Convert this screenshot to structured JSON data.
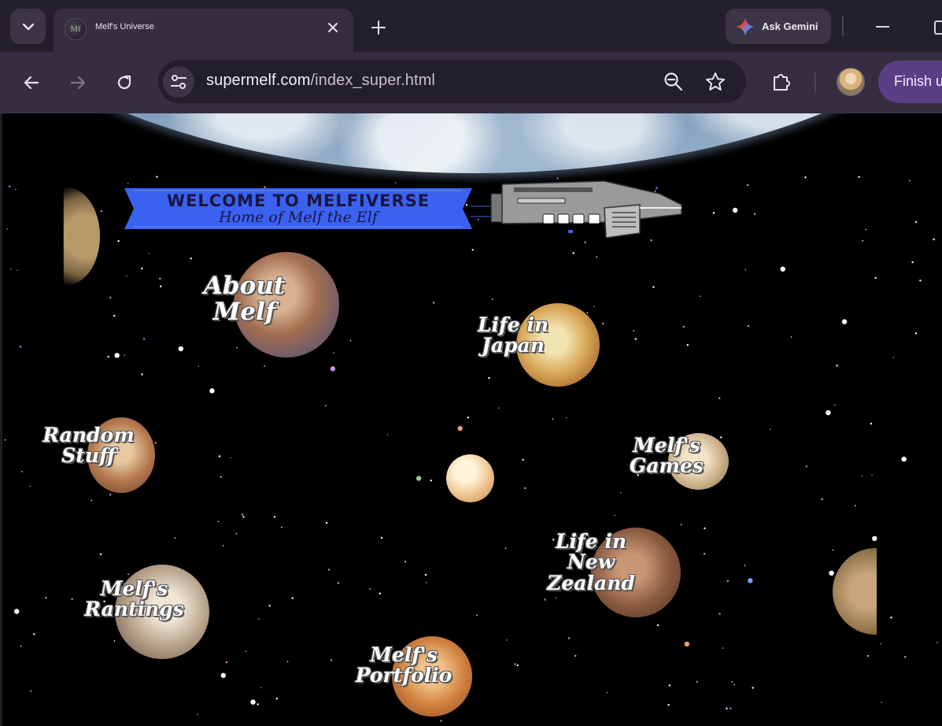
{
  "browser": {
    "tab": {
      "title": "Melf's Universe",
      "favicon_text": "Mf"
    },
    "gemini_label": "Ask Gemini",
    "url": {
      "host": "supermelf.com",
      "path": "/index_super.html"
    },
    "finish_label": "Finish u"
  },
  "page": {
    "banner": {
      "line1": "WELCOME TO MELFIVERSE",
      "line2": "Home of Melf the Elf"
    },
    "links": {
      "about": [
        "About",
        "Melf"
      ],
      "japan": [
        "Life in",
        "Japan"
      ],
      "random": [
        "Random",
        "Stuff"
      ],
      "games": [
        "Melf's",
        "Games"
      ],
      "nz": [
        "Life in",
        "New",
        "Zealand"
      ],
      "rantings": [
        "Melf's",
        "Rantings"
      ],
      "portfolio": [
        "Melf's",
        "Portfolio"
      ]
    }
  },
  "colors": {
    "tabbar": "#231f2b",
    "toolbar": "#352e40",
    "omnibox": "#231e2b",
    "finish_button": "#5b3f86",
    "space": "#000000",
    "banner_ribbon": "#3b61f0"
  },
  "icons": {
    "tab_list": "chevron-down-icon",
    "tab_close": "close-icon",
    "new_tab": "plus-icon",
    "gemini": "gemini-sparkle-icon",
    "back": "arrow-left-icon",
    "forward": "arrow-right-icon",
    "reload": "reload-icon",
    "site_info": "tune-icon",
    "zoom": "zoom-out-icon",
    "bookmark": "star-icon",
    "extensions": "puzzle-icon"
  }
}
